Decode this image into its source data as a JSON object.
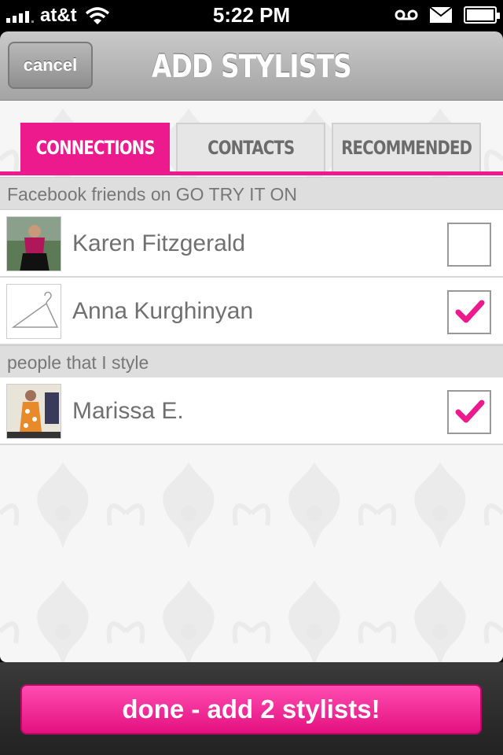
{
  "status_bar": {
    "carrier": "at&t",
    "time": "5:22 PM"
  },
  "nav": {
    "cancel_label": "cancel",
    "title": "ADD STYLISTS"
  },
  "tabs": [
    {
      "label": "CONNECTIONS",
      "active": true
    },
    {
      "label": "CONTACTS",
      "active": false
    },
    {
      "label": "RECOMMENDED",
      "active": false
    }
  ],
  "sections": [
    {
      "header": "Facebook friends on GO TRY IT ON",
      "items": [
        {
          "name": "Karen Fitzgerald",
          "checked": false,
          "avatar": "photo"
        },
        {
          "name": "Anna Kurghinyan",
          "checked": true,
          "avatar": "hanger-icon"
        }
      ]
    },
    {
      "header": "people that I style",
      "items": [
        {
          "name": "Marissa E.",
          "checked": true,
          "avatar": "photo"
        }
      ]
    }
  ],
  "done_button_label": "done - add 2 stylists!",
  "colors": {
    "accent": "#ec1a8c"
  }
}
